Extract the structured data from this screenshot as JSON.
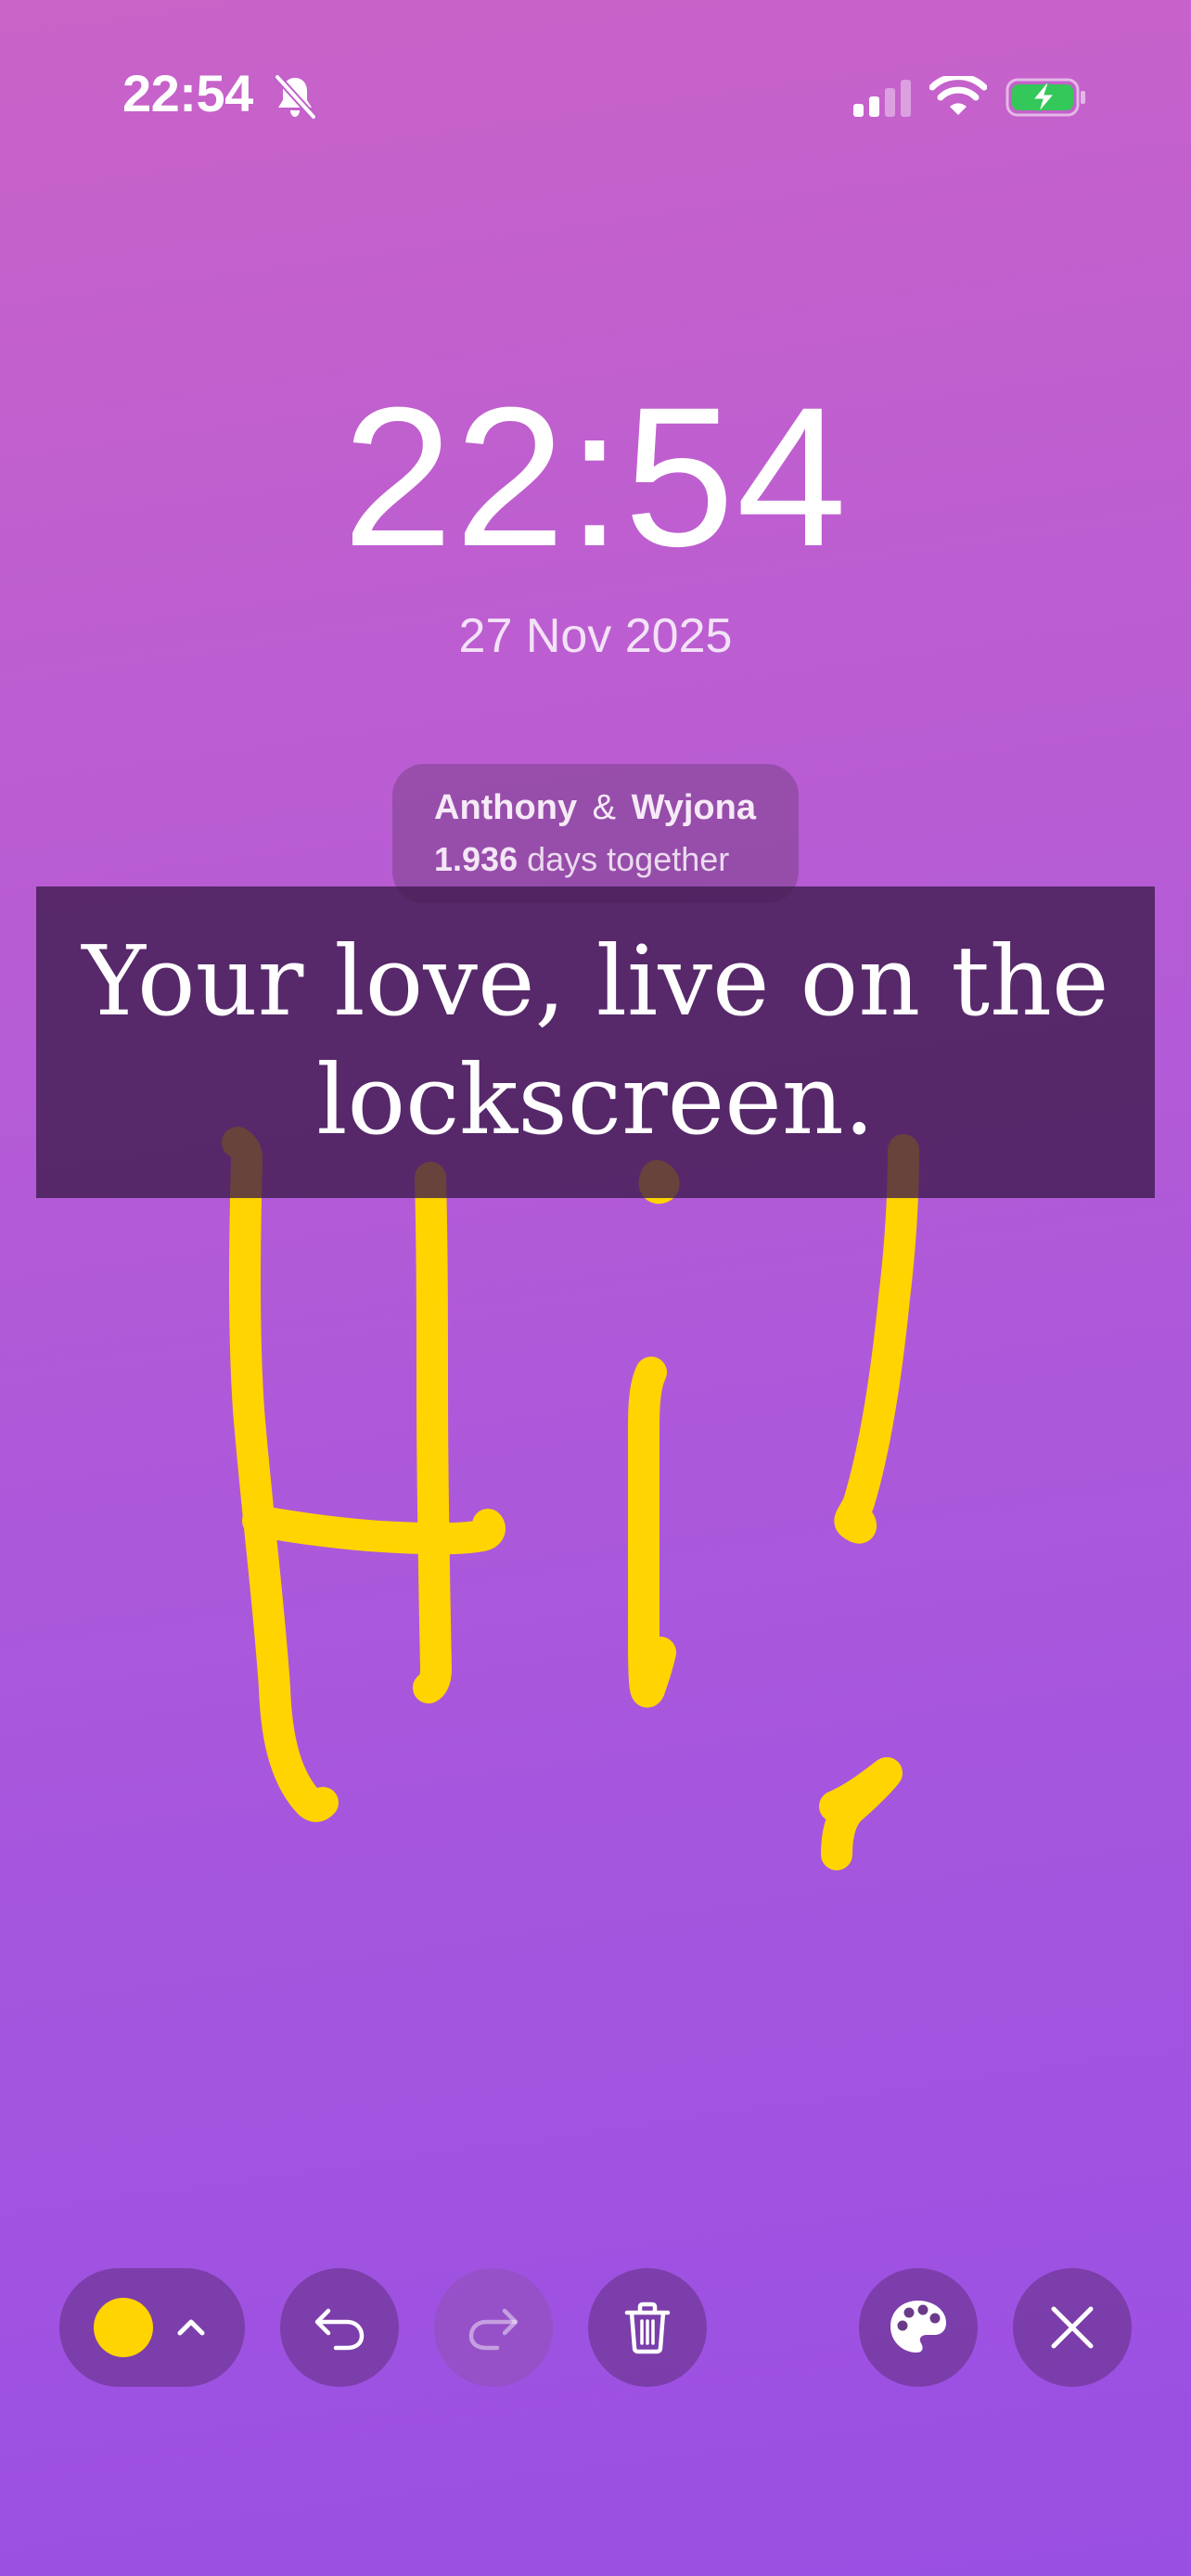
{
  "status_bar": {
    "time": "22:54",
    "icons": [
      "bell-muted-icon",
      "cellular-signal-icon",
      "wifi-icon",
      "battery-charging-icon"
    ]
  },
  "lockscreen": {
    "clock": "22:54",
    "date": "27 Nov 2025"
  },
  "couple_widget": {
    "name1": "Anthony",
    "amp": "&",
    "name2": "Wyjona",
    "days_count": "1.936",
    "days_label": "days together"
  },
  "banner": {
    "line1": "Your love, live on the",
    "line2": "lockscreen."
  },
  "drawing": {
    "description_icon": "handwritten-hi-drawing",
    "stroke_color": "#ffd400"
  },
  "toolbar": {
    "selected_color": "#ffd400",
    "buttons": [
      "color-picker",
      "undo-icon",
      "redo-icon",
      "trash-icon",
      "palette-icon",
      "close-icon"
    ],
    "redo_enabled": false
  },
  "colors": {
    "background_top": "#c963c8",
    "background_bottom": "#9a4fe3",
    "banner": "#3c194b",
    "stroke": "#ffd400",
    "battery_fill": "#34c759"
  }
}
